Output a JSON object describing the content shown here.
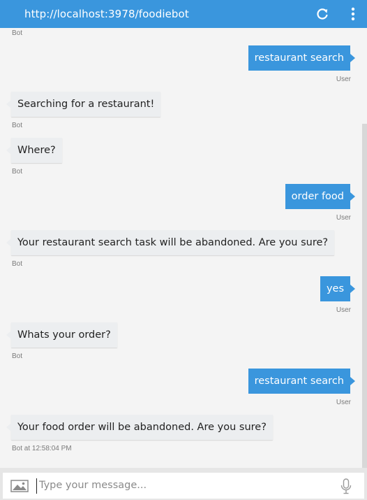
{
  "header": {
    "url": "http://localhost:3978/foodiebot",
    "refresh_icon": "refresh-icon",
    "more_icon": "more-vertical-icon"
  },
  "colors": {
    "accent": "#3a96dd",
    "bot_bubble": "#eceef0",
    "background": "#f4f4f4"
  },
  "conversation": {
    "top_meta": "Bot",
    "messages": [
      {
        "from": "user",
        "text": "restaurant search",
        "meta": "User"
      },
      {
        "from": "bot",
        "text": "Searching for a restaurant!",
        "meta": "Bot"
      },
      {
        "from": "bot",
        "text": "Where?",
        "meta": "Bot"
      },
      {
        "from": "user",
        "text": "order food",
        "meta": "User"
      },
      {
        "from": "bot",
        "text": "Your restaurant search task will be abandoned. Are you sure?",
        "meta": "Bot"
      },
      {
        "from": "user",
        "text": "yes",
        "meta": "User"
      },
      {
        "from": "bot",
        "text": "Whats your order?",
        "meta": "Bot"
      },
      {
        "from": "user",
        "text": "restaurant search",
        "meta": "User"
      },
      {
        "from": "bot",
        "text": "Your food order will be abandoned. Are you sure?",
        "meta": "Bot at 12:58:04 PM"
      }
    ]
  },
  "composer": {
    "placeholder": "Type your message...",
    "value": "",
    "image_icon": "image-icon",
    "mic_icon": "microphone-icon"
  }
}
